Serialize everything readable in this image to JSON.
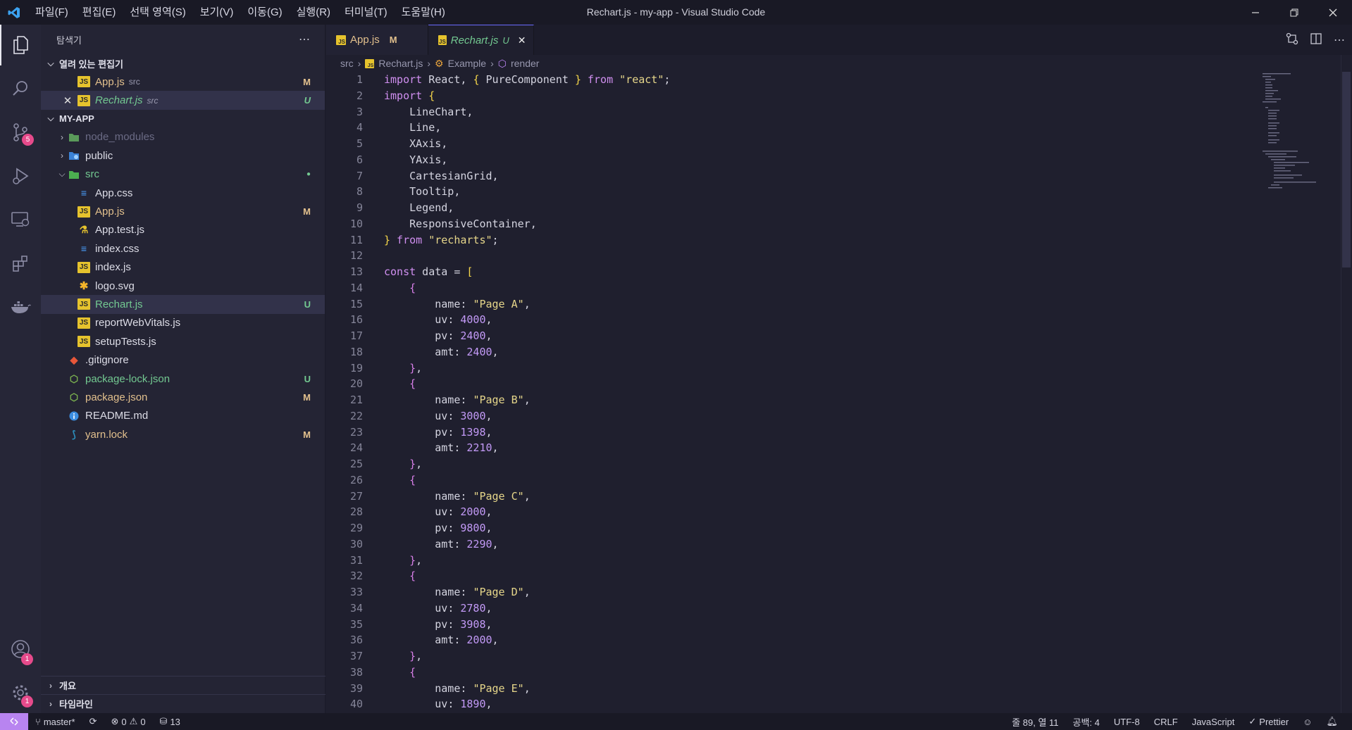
{
  "window": {
    "title": "Rechart.js - my-app - Visual Studio Code",
    "menu": [
      "파일(F)",
      "편집(E)",
      "선택 영역(S)",
      "보기(V)",
      "이동(G)",
      "실행(R)",
      "터미널(T)",
      "도움말(H)"
    ]
  },
  "activity": {
    "source_control_badge": "5",
    "accounts_badge": "1",
    "settings_badge": "1"
  },
  "sidebar": {
    "title": "탐색기",
    "open_editors_label": "열려 있는 편집기",
    "open_editors": [
      {
        "name": "App.js",
        "folder": "src",
        "status": "M"
      },
      {
        "name": "Rechart.js",
        "folder": "src",
        "status": "U"
      }
    ],
    "project_label": "MY-APP",
    "tree": [
      {
        "name": "node_modules",
        "status": ""
      },
      {
        "name": "public",
        "status": ""
      },
      {
        "name": "src",
        "status": "●"
      },
      {
        "name": "App.css",
        "status": ""
      },
      {
        "name": "App.js",
        "status": "M"
      },
      {
        "name": "App.test.js",
        "status": ""
      },
      {
        "name": "index.css",
        "status": ""
      },
      {
        "name": "index.js",
        "status": ""
      },
      {
        "name": "logo.svg",
        "status": ""
      },
      {
        "name": "Rechart.js",
        "status": "U"
      },
      {
        "name": "reportWebVitals.js",
        "status": ""
      },
      {
        "name": "setupTests.js",
        "status": ""
      },
      {
        "name": ".gitignore",
        "status": ""
      },
      {
        "name": "package-lock.json",
        "status": "U"
      },
      {
        "name": "package.json",
        "status": "M"
      },
      {
        "name": "README.md",
        "status": ""
      },
      {
        "name": "yarn.lock",
        "status": "M"
      }
    ],
    "outline_label": "개요",
    "timeline_label": "타임라인"
  },
  "tabs": [
    {
      "name": "App.js",
      "status": "M"
    },
    {
      "name": "Rechart.js",
      "status": "U"
    }
  ],
  "breadcrumb": [
    "src",
    "Rechart.js",
    "Example",
    "render"
  ],
  "code": {
    "line_numbers": [
      "1",
      "2",
      "3",
      "4",
      "5",
      "6",
      "7",
      "8",
      "9",
      "10",
      "11",
      "12",
      "13",
      "14",
      "15",
      "16",
      "17",
      "18",
      "19",
      "20",
      "21",
      "22",
      "23",
      "24",
      "25",
      "26",
      "27",
      "28",
      "29",
      "30",
      "31",
      "32",
      "33",
      "34",
      "35",
      "36",
      "37",
      "38",
      "39",
      "40"
    ],
    "line1": {
      "a": "import",
      "b": " React, ",
      "c": "{",
      "d": " PureComponent ",
      "e": "}",
      "f": " from ",
      "g": "\"react\"",
      "h": ";"
    },
    "line2": {
      "a": "import",
      "b": " ",
      "c": "{"
    },
    "imports": [
      "LineChart,",
      "Line,",
      "XAxis,",
      "YAxis,",
      "CartesianGrid,",
      "Tooltip,",
      "Legend,",
      "ResponsiveContainer,"
    ],
    "line11": {
      "a": "}",
      "b": " from ",
      "c": "\"recharts\"",
      "d": ";"
    },
    "line13": {
      "a": "const",
      "b": " data = ",
      "c": "["
    },
    "items": [
      {
        "name": "\"Page A\"",
        "uv": "4000",
        "pv": "2400",
        "amt": "2400"
      },
      {
        "name": "\"Page B\"",
        "uv": "3000",
        "pv": "1398",
        "amt": "2210"
      },
      {
        "name": "\"Page C\"",
        "uv": "2000",
        "pv": "9800",
        "amt": "2290"
      },
      {
        "name": "\"Page D\"",
        "uv": "2780",
        "pv": "3908",
        "amt": "2000"
      },
      {
        "name": "\"Page E\"",
        "uv": "1890"
      }
    ]
  },
  "status": {
    "branch": "master*",
    "errors": "0",
    "warnings": "0",
    "ports": "13",
    "position": "줄 89, 열 11",
    "indent": "공백: 4",
    "encoding": "UTF-8",
    "eol": "CRLF",
    "language": "JavaScript",
    "formatter": "Prettier"
  },
  "colors": {
    "accent": "#b884f0",
    "modified": "#e2c08d",
    "untracked": "#73c991",
    "badge": "#e64a8b"
  }
}
